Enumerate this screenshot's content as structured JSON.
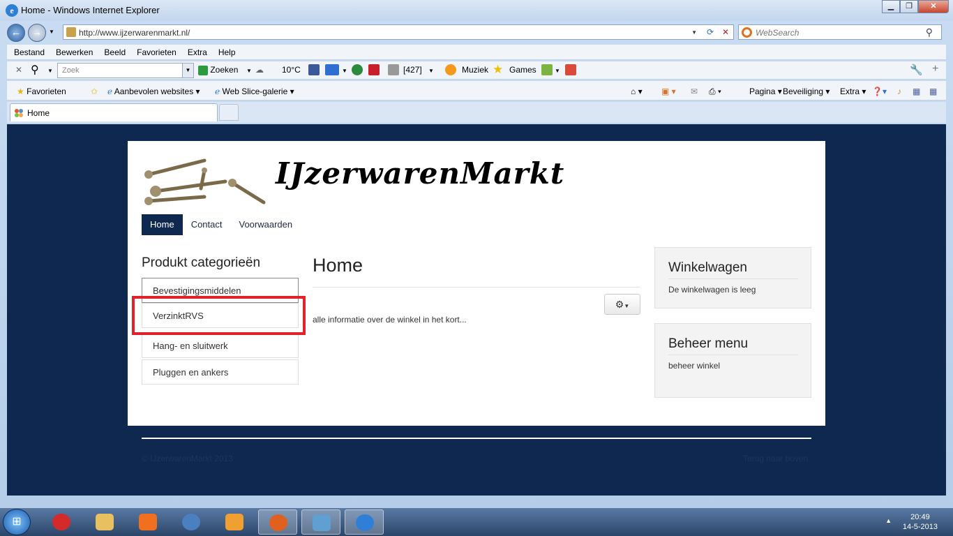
{
  "window": {
    "title": "Home - Windows Internet Explorer"
  },
  "address": {
    "url": "http://www.ijzerwarenmarkt.nl/",
    "search_placeholder": "WebSearch"
  },
  "menubar": [
    "Bestand",
    "Bewerken",
    "Beeld",
    "Favorieten",
    "Extra",
    "Help"
  ],
  "toolbar": {
    "search_placeholder": "Zoek",
    "zoeken": "Zoeken",
    "weather": "10°C",
    "count": "[427]",
    "muziek": "Muziek",
    "games": "Games"
  },
  "favbar": {
    "favorieten": "Favorieten",
    "aanbevolen": "Aanbevolen websites",
    "webslice": "Web Slice-galerie",
    "pagina": "Pagina",
    "beveiliging": "Beveiliging",
    "extra": "Extra"
  },
  "tab": {
    "label": "Home"
  },
  "site": {
    "brand": "IJzerwarenMarkt",
    "nav": [
      "Home",
      "Contact",
      "Voorwaarden"
    ],
    "categories_title": "Produkt categorieën",
    "categories": [
      "Bevestigingsmiddelen",
      "VerzinktRVS",
      "Hang- en sluitwerk",
      "Pluggen en ankers"
    ],
    "main_title": "Home",
    "intro": "alle informatie over de winkel in het kort...",
    "cart_title": "Winkelwagen",
    "cart_text": "De winkelwagen is leeg",
    "admin_title": "Beheer menu",
    "admin_text": "beheer winkel",
    "footer_left": "© IJzerwarenMarkt 2013",
    "footer_right": "Terug naar boven"
  },
  "taskbar": {
    "time": "20:49",
    "date": "14-5-2013"
  },
  "colors": {
    "page_bg": "#0f284f",
    "highlight": "#e0232b",
    "nav_active": "#0f284f"
  }
}
